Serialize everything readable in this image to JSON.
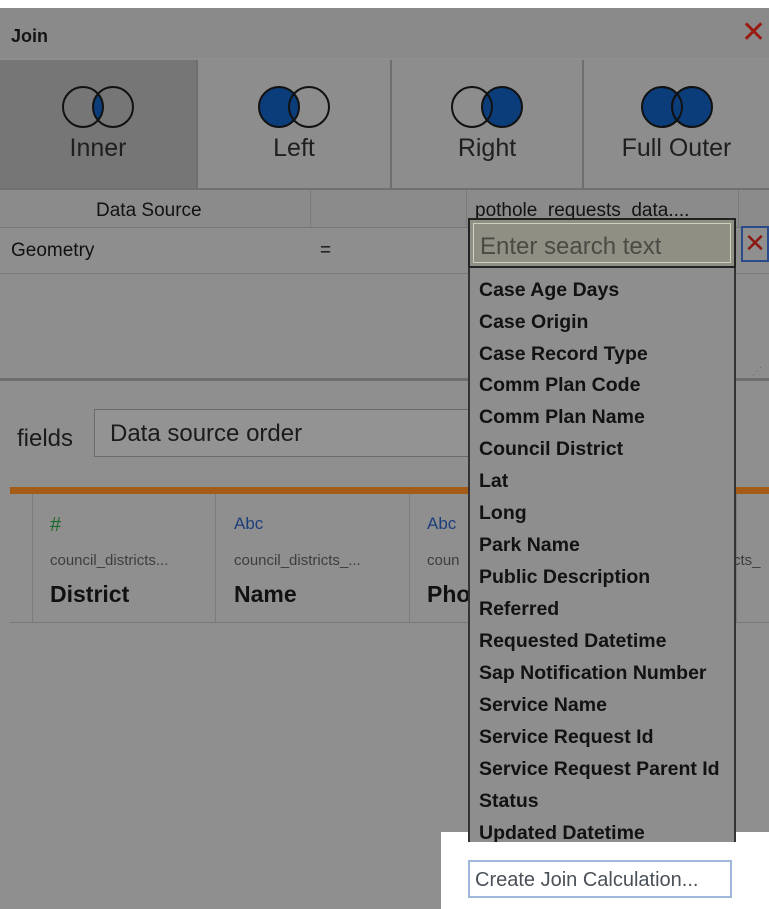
{
  "window": {
    "title": "Join",
    "close_glyph": "✕"
  },
  "join_types": [
    {
      "label": "Inner",
      "selected": true,
      "icon": "inner-join-icon"
    },
    {
      "label": "Left",
      "selected": false,
      "icon": "left-join-icon"
    },
    {
      "label": "Right",
      "selected": false,
      "icon": "right-join-icon"
    },
    {
      "label": "Full Outer",
      "selected": false,
      "icon": "full-outer-join-icon"
    }
  ],
  "clause_table": {
    "left_header": "Data Source",
    "right_header": "pothole_requests_data....",
    "rows": [
      {
        "left_field": "Geometry",
        "operator": "="
      }
    ]
  },
  "field_search": {
    "placeholder": "Enter search text",
    "clear_glyph": "✕",
    "options": [
      "Case Age Days",
      "Case Origin",
      "Case Record Type",
      "Comm Plan Code",
      "Comm Plan Name",
      "Council District",
      "Lat",
      "Long",
      "Park Name",
      "Public Description",
      "Referred",
      "Requested Datetime",
      "Sap Notification Number",
      "Service Name",
      "Service Request Id",
      "Service Request Parent Id",
      "Status",
      "Updated Datetime"
    ],
    "create_calc_label": "Create Join Calculation..."
  },
  "sort_bar": {
    "label": "fields",
    "order_value": "Data source order"
  },
  "grid_columns": [
    {
      "type_glyph": "#",
      "source": "council_districts...",
      "name": "District",
      "type_color": "#1a6a2a"
    },
    {
      "type_glyph": "Abc",
      "source": "council_districts_...",
      "name": "Name",
      "type_color": "#1d3f7a"
    },
    {
      "type_glyph": "Abc",
      "source": "coun",
      "name": "Pho",
      "type_color": "#1d3f7a"
    },
    {
      "type_glyph": "",
      "source": "cts_",
      "name": "",
      "type_color": "#1d3f7a"
    }
  ],
  "colors": {
    "venn_fill": "#0b3d7a",
    "accent_orange": "#a55c16"
  }
}
